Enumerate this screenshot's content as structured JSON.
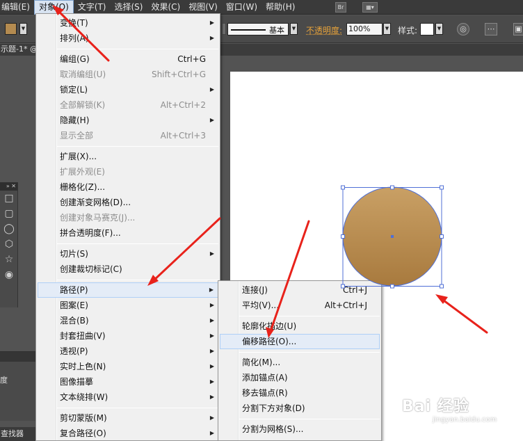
{
  "menubar": {
    "items": [
      "编辑(E)",
      "对象(O)",
      "文字(T)",
      "选择(S)",
      "效果(C)",
      "视图(V)",
      "窗口(W)",
      "帮助(H)"
    ],
    "bridge_icon": "Br"
  },
  "control_bar": {
    "fill_color": "#b48b50",
    "stroke_profile": "基本",
    "opacity_label": "不透明度:",
    "opacity_value": "100%",
    "style_label": "样式:"
  },
  "document": {
    "tab_title": "示题-1* @"
  },
  "object_menu": {
    "items": [
      {
        "label": "变换(T)",
        "submenu": true
      },
      {
        "label": "排列(A)",
        "submenu": true
      },
      {
        "label": "编组(G)",
        "shortcut": "Ctrl+G"
      },
      {
        "label": "取消编组(U)",
        "shortcut": "Shift+Ctrl+G",
        "disabled": true
      },
      {
        "label": "锁定(L)",
        "submenu": true
      },
      {
        "label": "全部解锁(K)",
        "shortcut": "Alt+Ctrl+2",
        "disabled": true
      },
      {
        "label": "隐藏(H)",
        "submenu": true
      },
      {
        "label": "显示全部",
        "shortcut": "Alt+Ctrl+3",
        "disabled": true
      },
      {
        "label": "扩展(X)..."
      },
      {
        "label": "扩展外观(E)",
        "disabled": true
      },
      {
        "label": "栅格化(Z)..."
      },
      {
        "label": "创建渐变网格(D)..."
      },
      {
        "label": "创建对象马赛克(J)...",
        "disabled": true
      },
      {
        "label": "拼合透明度(F)..."
      },
      {
        "label": "切片(S)",
        "submenu": true
      },
      {
        "label": "创建裁切标记(C)"
      },
      {
        "label": "路径(P)",
        "submenu": true,
        "highlighted": true
      },
      {
        "label": "图案(E)",
        "submenu": true
      },
      {
        "label": "混合(B)",
        "submenu": true
      },
      {
        "label": "封套扭曲(V)",
        "submenu": true
      },
      {
        "label": "透视(P)",
        "submenu": true
      },
      {
        "label": "实时上色(N)",
        "submenu": true
      },
      {
        "label": "图像描摹",
        "submenu": true
      },
      {
        "label": "文本绕排(W)",
        "submenu": true
      },
      {
        "label": "剪切蒙版(M)",
        "submenu": true
      },
      {
        "label": "复合路径(O)",
        "submenu": true
      }
    ]
  },
  "path_menu": {
    "items": [
      {
        "label": "连接(J)",
        "shortcut": "Ctrl+J"
      },
      {
        "label": "平均(V)...",
        "shortcut": "Alt+Ctrl+J"
      },
      {
        "label": "轮廓化描边(U)"
      },
      {
        "label": "偏移路径(O)...",
        "highlighted": true
      },
      {
        "label": "简化(M)..."
      },
      {
        "label": "添加锚点(A)"
      },
      {
        "label": "移去锚点(R)"
      },
      {
        "label": "分割下方对象(D)"
      },
      {
        "label": "分割为网格(S)..."
      }
    ]
  },
  "panels": {
    "lower_panel_label": "度",
    "bottom_tab": "查找器"
  },
  "artwork": {
    "circle_color": "#b48b50",
    "arrow_color": "#e8221b",
    "selection_color": "#4f6fd6"
  },
  "watermark": {
    "main": "Bai 经验",
    "sub": "jingyan.baidu.com"
  }
}
